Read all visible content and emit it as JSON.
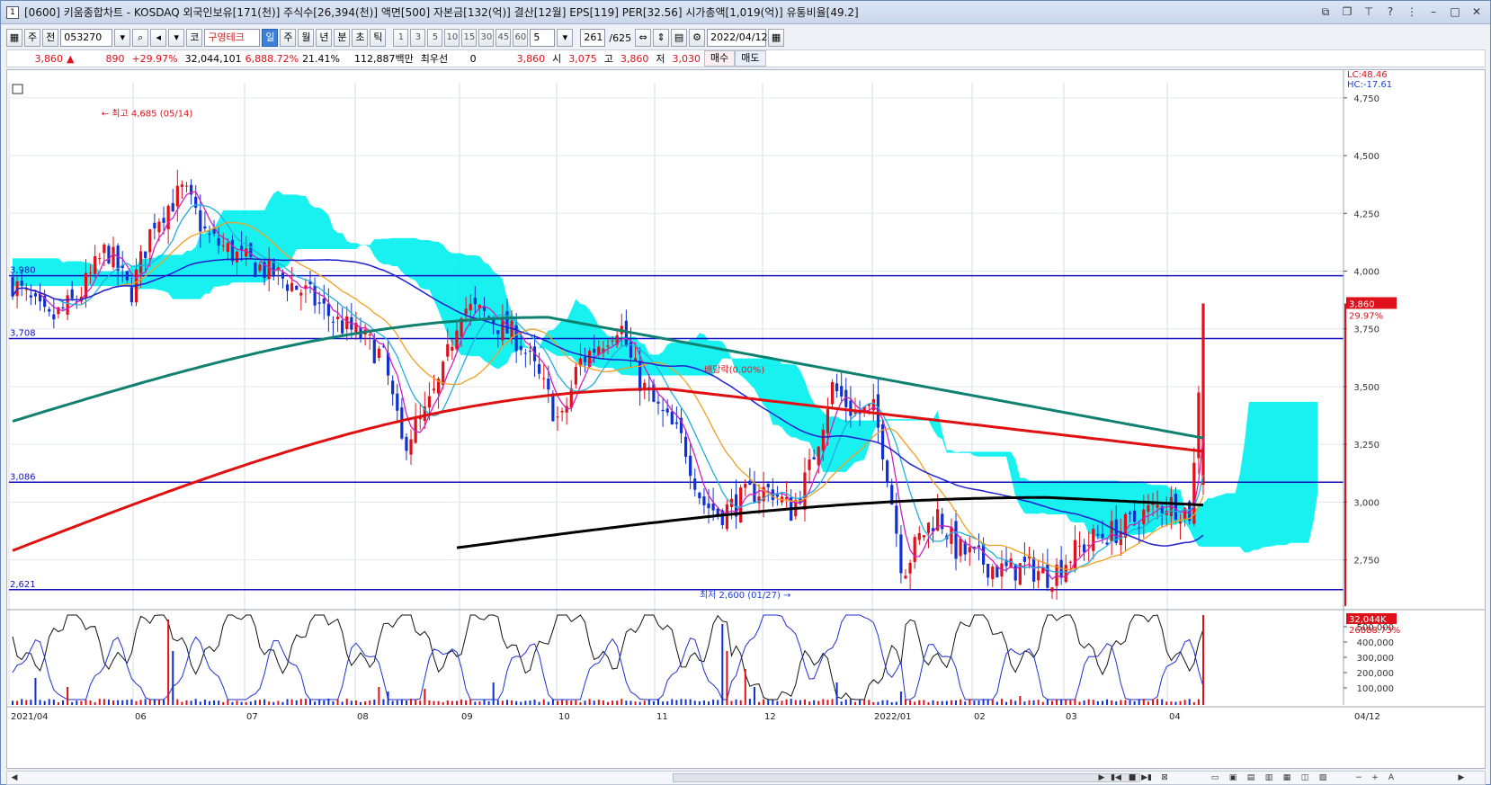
{
  "window": {
    "title": "[0600] 키움종합차트 - KOSDAQ 외국인보유[171(천)] 주식수[26,394(천)] 액면[500] 자본금[132(억)] 결산[12월] EPS[119] PER[32.56] 시가총액[1,019(억)] 유통비율[49.2]",
    "icon_text": "1"
  },
  "toolbar": {
    "market": "주",
    "prev": "전",
    "code": "053270",
    "market2": "코",
    "stock_name": "구영테크",
    "periods": [
      "일",
      "주",
      "월",
      "년",
      "분",
      "초",
      "틱"
    ],
    "active_period": "일",
    "intervals": [
      "1",
      "3",
      "5",
      "10",
      "15",
      "30",
      "45",
      "60"
    ],
    "interval_value": "5",
    "count": "261",
    "total": "/625",
    "date": "2022/04/12"
  },
  "quote": {
    "price": "3,860",
    "change": "890",
    "change_pct": "+29.97%",
    "volume": "32,044,101",
    "volume_pct": "6,888.72%",
    "turnover": "21.41%",
    "amount": "112,887백만",
    "best_label": "최우선",
    "best_value": "0",
    "ask": "3,860",
    "open_label": "시",
    "open": "3,075",
    "high_label": "고",
    "high": "3,860",
    "low_label": "저",
    "low": "3,030",
    "buy": "매수",
    "sell": "매도"
  },
  "annotations": {
    "high_note": "최고 4,685 (05/14)",
    "low_note": "최저 2,600 (01/27)",
    "dividend": "배당락(0.00%)",
    "lc": "LC:48.46",
    "hc": "HC:-17.61",
    "cur_price": "3,860",
    "cur_pct": "29.97%",
    "vol_box": "32,044K",
    "vol_pct": "26888.73%"
  },
  "colors": {
    "cloud": "#00f0f0",
    "up": "#e0101a",
    "down": "#1030d0",
    "ma5": "#d020c0",
    "ma10": "#20b0e0",
    "ma20": "#f0a020",
    "ma60": "#2020d0",
    "ma120": "#108070",
    "ma240": "#e01010",
    "ma_black": "#000000",
    "hline": "#1010c0"
  },
  "chart_data": {
    "type": "candlestick",
    "y_ticks": [
      "4,750",
      "4,500",
      "4,250",
      "4,000",
      "3,750",
      "3,500",
      "3,250",
      "3,000",
      "2,750"
    ],
    "ylim": [
      2550,
      4800
    ],
    "x_labels": [
      "2021/04",
      "06",
      "07",
      "08",
      "09",
      "10",
      "11",
      "12",
      "2022/01",
      "02",
      "03",
      "04"
    ],
    "last_x_label": "04/12",
    "h_lines": [
      {
        "label": "3,980",
        "value": 3980
      },
      {
        "label": "3,708",
        "value": 3708
      },
      {
        "label": "3,086",
        "value": 3086
      },
      {
        "label": "2,621",
        "value": 2621
      }
    ],
    "volume_ticks": [
      "500,000",
      "400,000",
      "300,000",
      "200,000",
      "100,000"
    ]
  }
}
